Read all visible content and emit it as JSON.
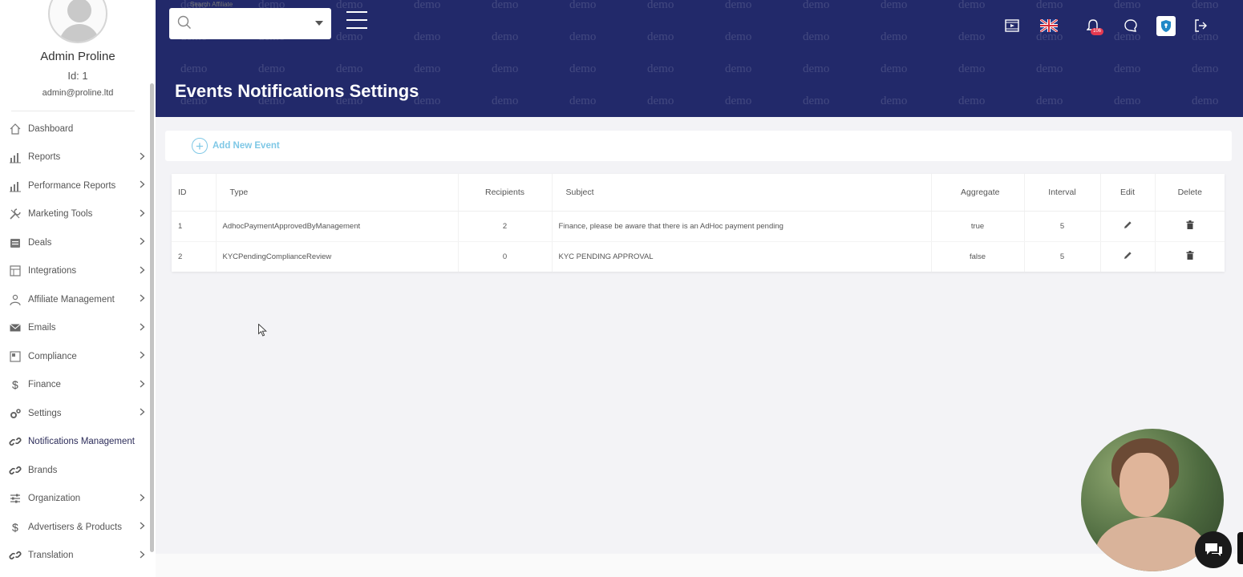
{
  "user": {
    "name": "Admin Proline",
    "id_label": "Id: 1",
    "email": "admin@proline.ltd"
  },
  "sidebar": {
    "items": [
      {
        "label": "Dashboard",
        "icon": "home-icon",
        "chevron": false
      },
      {
        "label": "Reports",
        "icon": "bar-chart-icon",
        "chevron": true
      },
      {
        "label": "Performance Reports",
        "icon": "bar-chart-icon",
        "chevron": true
      },
      {
        "label": "Marketing Tools",
        "icon": "tools-icon",
        "chevron": true
      },
      {
        "label": "Deals",
        "icon": "deals-icon",
        "chevron": true
      },
      {
        "label": "Integrations",
        "icon": "integrations-icon",
        "chevron": true
      },
      {
        "label": "Affiliate Management",
        "icon": "affiliate-icon",
        "chevron": true
      },
      {
        "label": "Emails",
        "icon": "envelope-icon",
        "chevron": true
      },
      {
        "label": "Compliance",
        "icon": "compliance-icon",
        "chevron": true
      },
      {
        "label": "Finance",
        "icon": "dollar-icon",
        "chevron": true
      },
      {
        "label": "Settings",
        "icon": "gears-icon",
        "chevron": true
      },
      {
        "label": "Notifications Management",
        "icon": "link-icon",
        "chevron": false,
        "active": true
      },
      {
        "label": "Brands",
        "icon": "link-icon",
        "chevron": false
      },
      {
        "label": "Organization",
        "icon": "sliders-icon",
        "chevron": true
      },
      {
        "label": "Advertisers & Products",
        "icon": "dollar-icon",
        "chevron": true
      },
      {
        "label": "Translation",
        "icon": "link-icon",
        "chevron": true
      }
    ]
  },
  "header": {
    "search_label": "Search Affiliate",
    "search_value": "",
    "watermark": "demo",
    "page_title": "Events Notifications Settings",
    "notification_count": "106"
  },
  "actions": {
    "add_event_label": "Add New Event"
  },
  "table": {
    "columns": [
      "ID",
      "Type",
      "Recipients",
      "Subject",
      "Aggregate",
      "Interval",
      "Edit",
      "Delete"
    ],
    "rows": [
      {
        "id": "1",
        "type": "AdhocPaymentApprovedByManagement",
        "recipients": "2",
        "subject": "Finance, please be aware that there is an AdHoc payment pending",
        "aggregate": "true",
        "interval": "5"
      },
      {
        "id": "2",
        "type": "KYCPendingComplianceReview",
        "recipients": "0",
        "subject": "KYC PENDING APPROVAL",
        "aggregate": "false",
        "interval": "5"
      }
    ]
  },
  "colors": {
    "header_bg": "#22296a",
    "accent": "#7fc8e6",
    "badge": "#e53950"
  }
}
